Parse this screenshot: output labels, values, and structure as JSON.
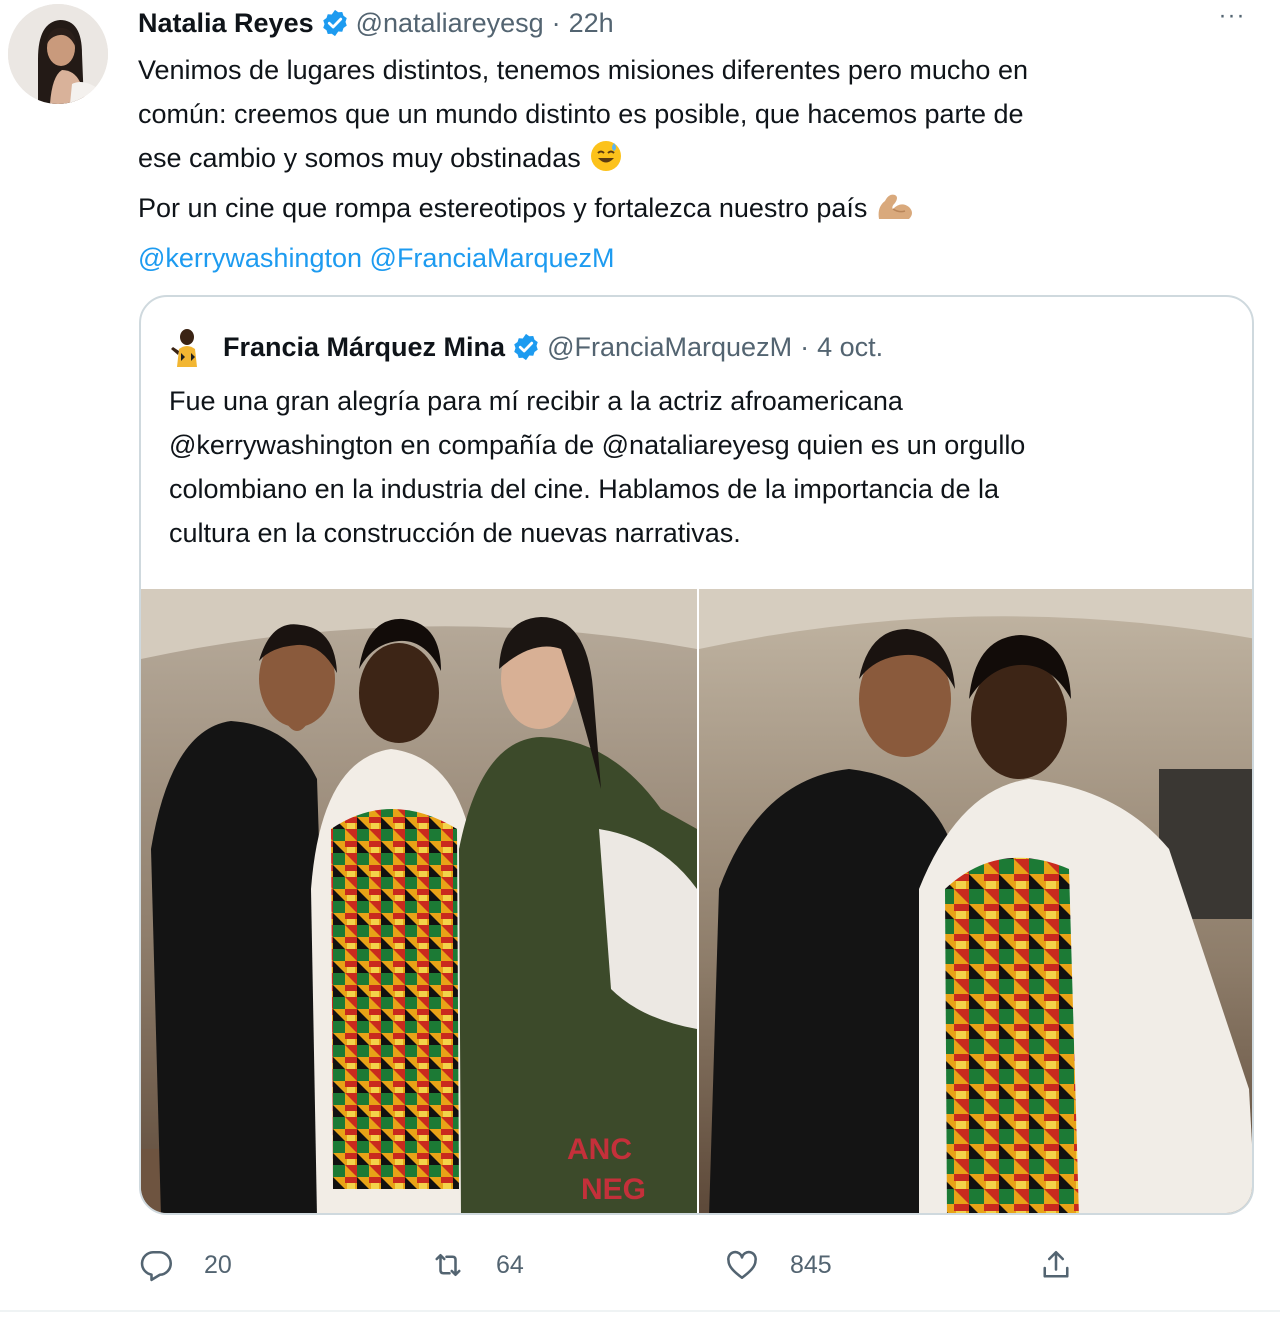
{
  "tweet": {
    "author": {
      "name": "Natalia Reyes",
      "handle": "@nataliareyesg",
      "separator": "·",
      "time": "22h",
      "verified": true
    },
    "more_label": "···",
    "text_lines": [
      "Venimos de lugares distintos, tenemos misiones diferentes pero mucho en",
      "común: creemos que un mundo distinto es posible, que hacemos parte de",
      "ese cambio y somos muy obstinadas",
      "Por un cine que rompa estereotipos y fortalezca nuestro país"
    ],
    "mentions": [
      "@kerrywashington",
      "@FranciaMarquezM"
    ],
    "emojis": [
      "sweat-smile-emoji",
      "flexed-biceps-emoji"
    ]
  },
  "quoted_tweet": {
    "author": {
      "name": "Francia Márquez Mina",
      "handle": "@FranciaMarquezM",
      "separator": "·",
      "time": "4 oct.",
      "verified": true
    },
    "text_lines": [
      "Fue una gran alegría para mí recibir a la actriz afroamericana",
      "@kerrywashington en compañía de @nataliareyesg quien es un orgullo",
      "colombiano en la industria del cine. Hablamos de la importancia de la",
      "cultura en la construcción de nuevas narrativas."
    ],
    "photos": [
      "group-photo-three-women",
      "photo-two-women"
    ],
    "photo_overlay_text": [
      "ANC",
      "NEG"
    ]
  },
  "actions": {
    "reply_count": "20",
    "retweet_count": "64",
    "like_count": "845",
    "share_icon": "share-icon"
  },
  "colors": {
    "text": "#0f1419",
    "secondary": "#536471",
    "link": "#1d9bf0",
    "border": "#cfd9de",
    "verified": "#1d9bf0"
  }
}
